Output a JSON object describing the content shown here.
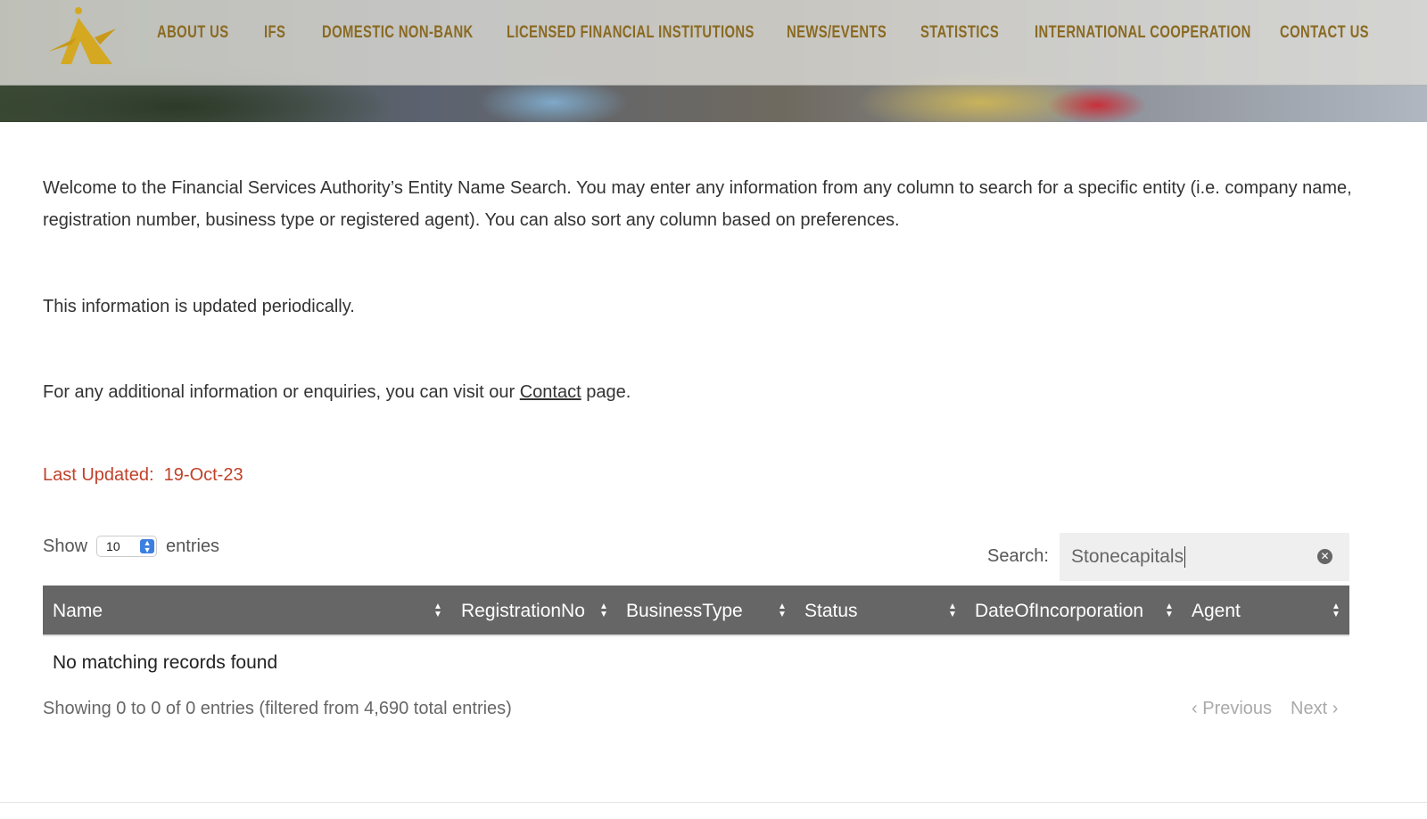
{
  "nav": {
    "items": [
      "ABOUT US",
      "IFS",
      "DOMESTIC NON-BANK",
      "LICENSED FINANCIAL INSTITUTIONS",
      "NEWS/EVENTS",
      "STATISTICS",
      "INTERNATIONAL COOPERATION",
      "CONTACT US"
    ],
    "color": "#8a6a22"
  },
  "intro": {
    "p1": "Welcome to the Financial Services Authority’s Entity Name Search. You may enter any information from any column to search for a specific entity (i.e. company name, registration number, business type or registered agent). You can also sort any column based on preferences.",
    "p2": "This information is updated periodically.",
    "p3_before": "For any additional information or enquiries, you can visit our ",
    "p3_link": "Contact",
    "p3_after": " page.",
    "last_updated_label": "Last Updated:",
    "last_updated_value": "19-Oct-23"
  },
  "table": {
    "show_label": "Show",
    "entries_label": "entries",
    "page_size": "10",
    "search_label": "Search:",
    "search_value": "Stonecapitals",
    "columns": [
      "Name",
      "RegistrationNo",
      "BusinessType",
      "Status",
      "DateOfIncorporation",
      "Agent"
    ],
    "empty_message": "No matching records found",
    "info": "Showing 0 to 0 of 0 entries (filtered from 4,690 total entries)",
    "previous": "Previous",
    "next": "Next",
    "header_color": "#666666"
  }
}
